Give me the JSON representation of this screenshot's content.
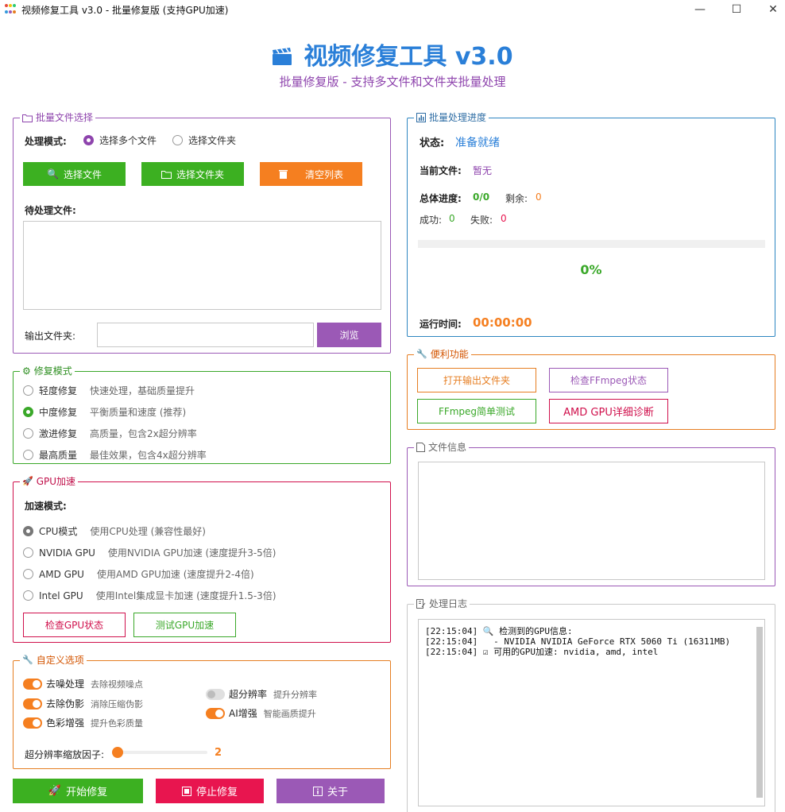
{
  "window": {
    "title": "视频修复工具 v3.0 - 批量修复版 (支持GPU加速)",
    "minimize": "—",
    "maximize": "☐",
    "close": "✕"
  },
  "header": {
    "title": "视频修复工具 v3.0",
    "subtitle": "批量修复版 - 支持多文件和文件夹批量处理"
  },
  "file_select": {
    "group_label": "批量文件选择",
    "mode_label": "处理模式:",
    "mode_multi": "选择多个文件",
    "mode_folder": "选择文件夹",
    "btn_select_files": "选择文件",
    "btn_select_folder": "选择文件夹",
    "btn_clear": "清空列表",
    "pending_label": "待处理文件:",
    "output_label": "输出文件夹:",
    "output_value": "",
    "btn_browse": "浏览"
  },
  "repair_mode": {
    "group_label": "修复模式",
    "options": [
      {
        "name": "轻度修复",
        "desc": "快速处理，基础质量提升",
        "selected": false
      },
      {
        "name": "中度修复",
        "desc": "平衡质量和速度 (推荐)",
        "selected": true
      },
      {
        "name": "激进修复",
        "desc": "高质量，包含2x超分辨率",
        "selected": false
      },
      {
        "name": "最高质量",
        "desc": "最佳效果，包含4x超分辨率",
        "selected": false
      }
    ]
  },
  "gpu": {
    "group_label": "GPU加速",
    "mode_label": "加速模式:",
    "options": [
      {
        "name": "CPU模式",
        "desc": "使用CPU处理 (兼容性最好)",
        "selected": true
      },
      {
        "name": "NVIDIA GPU",
        "desc": "使用NVIDIA GPU加速 (速度提升3-5倍)",
        "selected": false
      },
      {
        "name": "AMD GPU",
        "desc": "使用AMD GPU加速 (速度提升2-4倍)",
        "selected": false
      },
      {
        "name": "Intel GPU",
        "desc": "使用Intel集成显卡加速 (速度提升1.5-3倍)",
        "selected": false
      }
    ],
    "btn_check": "检查GPU状态",
    "btn_test": "测试GPU加速"
  },
  "custom": {
    "group_label": "自定义选项",
    "denoise": {
      "label": "去噪处理",
      "desc": "去除视频噪点",
      "on": true
    },
    "deartifact": {
      "label": "去除伪影",
      "desc": "消除压缩伪影",
      "on": true
    },
    "color": {
      "label": "色彩增强",
      "desc": "提升色彩质量",
      "on": true
    },
    "superres": {
      "label": "超分辨率",
      "desc": "提升分辨率",
      "on": false
    },
    "ai": {
      "label": "AI增强",
      "desc": "智能画质提升",
      "on": true
    },
    "scale_label": "超分辨率缩放因子:",
    "scale_value": "2"
  },
  "actions": {
    "start": "开始修复",
    "stop": "停止修复",
    "about": "关于"
  },
  "progress": {
    "group_label": "批量处理进度",
    "status_label": "状态:",
    "status_value": "准备就绪",
    "current_label": "当前文件:",
    "current_value": "暂无",
    "overall_label": "总体进度:",
    "overall_value": "0/0",
    "remaining_label": "剩余:",
    "remaining_value": "0",
    "success_label": "成功:",
    "success_value": "0",
    "failed_label": "失败:",
    "failed_value": "0",
    "percent": "0%",
    "runtime_label": "运行时间:",
    "runtime_value": "00:00:00"
  },
  "tools": {
    "group_label": "便利功能",
    "open_output": "打开输出文件夹",
    "check_ffmpeg": "检查FFmpeg状态",
    "ffmpeg_test": "FFmpeg简单测试",
    "amd_diag": "AMD GPU详细诊断"
  },
  "file_info": {
    "group_label": "文件信息"
  },
  "log": {
    "group_label": "处理日志",
    "lines": [
      "[22:15:04] 🔍 检测到的GPU信息:",
      "[22:15:04]   - NVIDIA NVIDIA GeForce RTX 5060 Ti (16311MB)",
      "[22:15:04] ☑ 可用的GPU加速: nvidia, amd, intel"
    ]
  },
  "colors": {
    "accent_blue": "#2a7fd8",
    "purple": "#9b59b6",
    "green": "#3cb021",
    "orange": "#f57f20",
    "red": "#e8154f"
  }
}
